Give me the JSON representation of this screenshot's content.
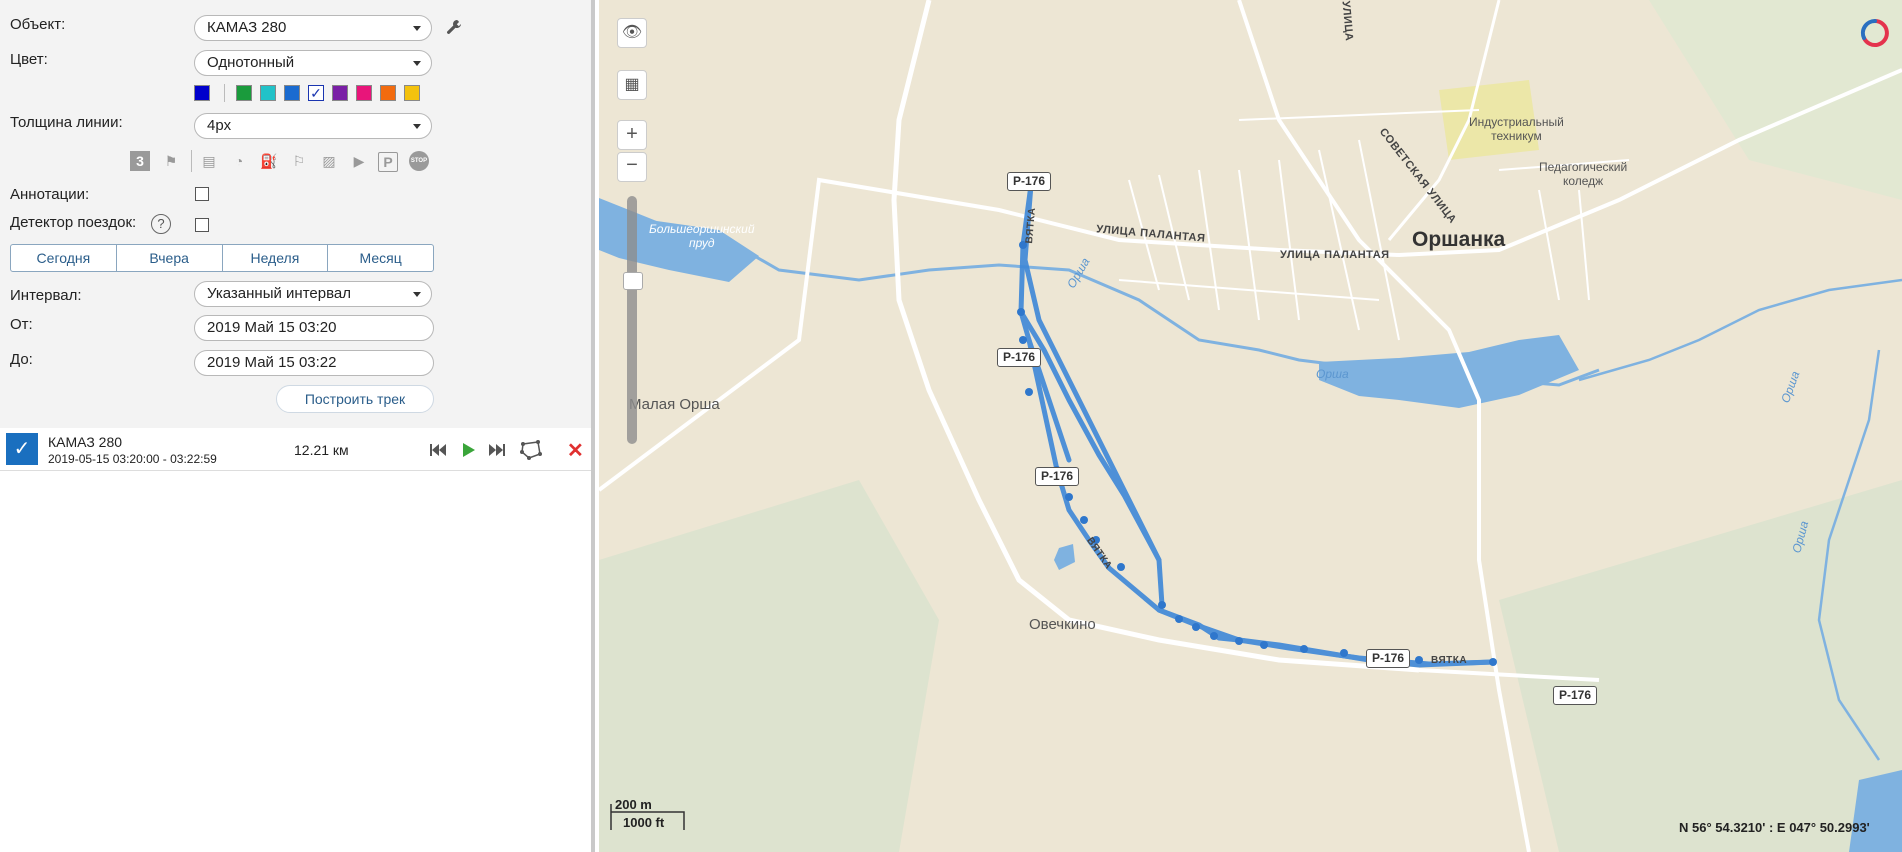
{
  "form": {
    "object_label": "Объект:",
    "object_value": "КАМАЗ 280",
    "color_label": "Цвет:",
    "color_value": "Однотонный",
    "colors": [
      "#0000cc",
      "#1a9b3c",
      "#21c2c8",
      "#1a6bd0",
      "#ffffff",
      "#7a1fa6",
      "#e8157a",
      "#f26b0f",
      "#f4c20d"
    ],
    "selected_color_index": 4,
    "thickness_label": "Толщина линии:",
    "thickness_value": "4px",
    "toolbar_icons": [
      "three-icon",
      "flags-icon",
      "document-icon",
      "gauge-icon",
      "fuel-icon",
      "flag-icon",
      "image-icon",
      "video-icon",
      "parking-icon",
      "stop-icon"
    ],
    "annotations_label": "Аннотации:",
    "trip_detector_label": "Детектор поездок:",
    "help_symbol": "?",
    "periods": [
      "Сегодня",
      "Вчера",
      "Неделя",
      "Месяц"
    ],
    "interval_label": "Интервал:",
    "interval_value": "Указанный интервал",
    "from_label": "От:",
    "from_value": "2019 Май 15 03:20",
    "to_label": "До:",
    "to_value": "2019 Май 15 03:22",
    "build_button": "Построить трек"
  },
  "track": {
    "name": "КАМАЗ 280",
    "time_range": "2019-05-15  03:20:00 - 03:22:59",
    "distance": "12.21 км"
  },
  "map": {
    "labels": {
      "orshanka": "Оршанка",
      "industrial": "Индустриальный\nтехникум",
      "pedagogical": "Педагогический\nколедж",
      "bolshe": "Большеоршинский\nпруд",
      "malaya": "Малая Орша",
      "ovechkino": "Овечкино",
      "palantaya1": "УЛИЦА ПАЛАНТАЯ",
      "palantaya2": "УЛИЦА ПАЛАНТАЯ",
      "sovetskaya": "СОВЕТСКАЯ УЛИЦА",
      "ulitsa": "УЛИЦА",
      "orsha1": "Орша",
      "orsha2": "Орша",
      "orsha3": "Орша",
      "orsha4": "Орша",
      "vyatka1": "ВЯТКА",
      "vyatka2": "ВЯТКА",
      "vyatka3": "ВЯТКА"
    },
    "road_badges": [
      "Р-176",
      "Р-176",
      "Р-176",
      "Р-176",
      "Р-176"
    ],
    "scale_m": "200 m",
    "scale_ft": "1000 ft",
    "coords": "N 56° 54.3210' : E 047° 50.2993'"
  }
}
